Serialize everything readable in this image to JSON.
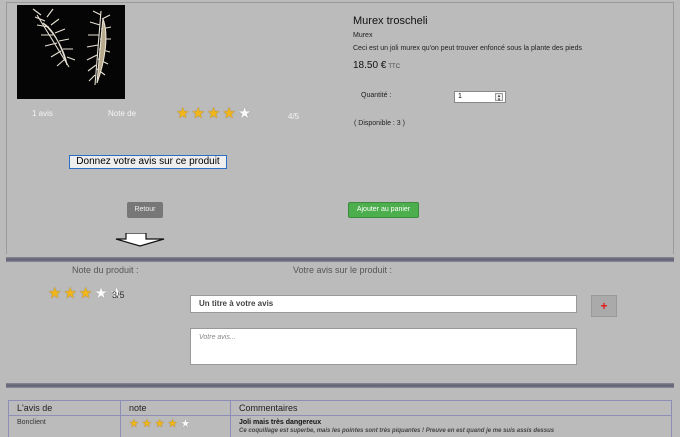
{
  "product": {
    "name": "Murex troscheli",
    "category": "Murex",
    "description": "Ceci est un joli murex qu'on peut trouver enfoncé sous la plante des pieds",
    "price": "18.50 €",
    "price_suffix": "TTC",
    "quantity_label": "Quantité :",
    "quantity_value": "1",
    "availability": "( Disponible : 3 )",
    "reviews_count": "1 avis",
    "rating_label": "Note de",
    "rating_score": "4/5",
    "rating_value": 4
  },
  "actions": {
    "give_review": "Donnez votre avis sur ce produit",
    "back": "Retour",
    "add_to_cart": "Ajouter au panier"
  },
  "review_form": {
    "rating_label": "Note du produit :",
    "rating_score": "3/5",
    "rating_value": 3,
    "form_label": "Votre avis sur le produit :",
    "title_placeholder": "Un titre à votre avis",
    "body_placeholder": "Votre avis...",
    "add_symbol": "+"
  },
  "reviews_table": {
    "headers": [
      "L'avis de",
      "note",
      "Commentaires"
    ],
    "rows": [
      {
        "author": "Bonclient",
        "rating": 4,
        "title": "Joli mais très dangereux",
        "comment": "Ce coquillage est superbe, mais les pointes sont très piquantes ! Preuve en est quand je me suis assis dessus"
      }
    ]
  },
  "colors": {
    "background": "#bbbbbb",
    "star": "#f1b61a",
    "cart_button": "#4cae4c",
    "back_button": "#777777",
    "plus": "#e01b1b"
  },
  "icons": [
    "shell-image",
    "star-icon",
    "down-arrow-icon",
    "spinner-icon"
  ]
}
